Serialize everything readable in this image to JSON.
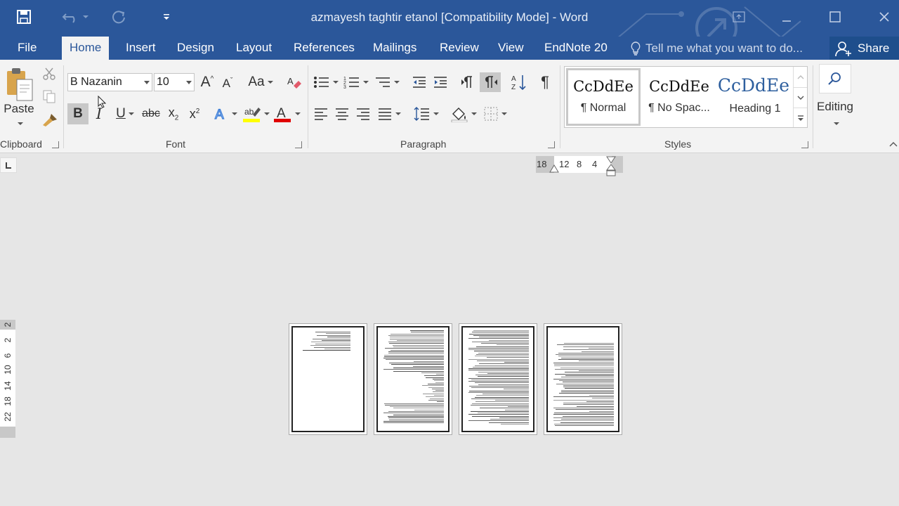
{
  "window": {
    "title": "azmayesh taghtir etanol [Compatibility Mode] - Word"
  },
  "tabs": [
    {
      "label": "File"
    },
    {
      "label": "Home"
    },
    {
      "label": "Insert"
    },
    {
      "label": "Design"
    },
    {
      "label": "Layout"
    },
    {
      "label": "References"
    },
    {
      "label": "Mailings"
    },
    {
      "label": "Review"
    },
    {
      "label": "View"
    },
    {
      "label": "EndNote 20"
    }
  ],
  "active_tab": "Home",
  "tell_me": {
    "placeholder": "Tell me what you want to do..."
  },
  "share_label": "Share",
  "ribbon": {
    "clipboard": {
      "label": "Clipboard",
      "paste_label": "Paste"
    },
    "font": {
      "label": "Font",
      "font_name": "B Nazanin",
      "font_size": "10",
      "change_case": "Aa"
    },
    "paragraph": {
      "label": "Paragraph"
    },
    "styles": {
      "label": "Styles",
      "items": [
        {
          "sample": "CcDdEe",
          "name": "¶ Normal"
        },
        {
          "sample": "CcDdEe",
          "name": "¶ No Spac..."
        },
        {
          "sample": "CcDdEe",
          "name": "Heading 1"
        }
      ]
    },
    "editing": {
      "label": "Editing"
    }
  },
  "ruler": {
    "horizontal": [
      "18",
      "12",
      "8",
      "4"
    ],
    "vertical": [
      "2",
      "2",
      "6",
      "10",
      "14",
      "18",
      "22"
    ]
  },
  "colors": {
    "brand": "#2b579a",
    "highlight": "#ffff00",
    "font_color": "#e00000"
  },
  "pages_count": 4
}
